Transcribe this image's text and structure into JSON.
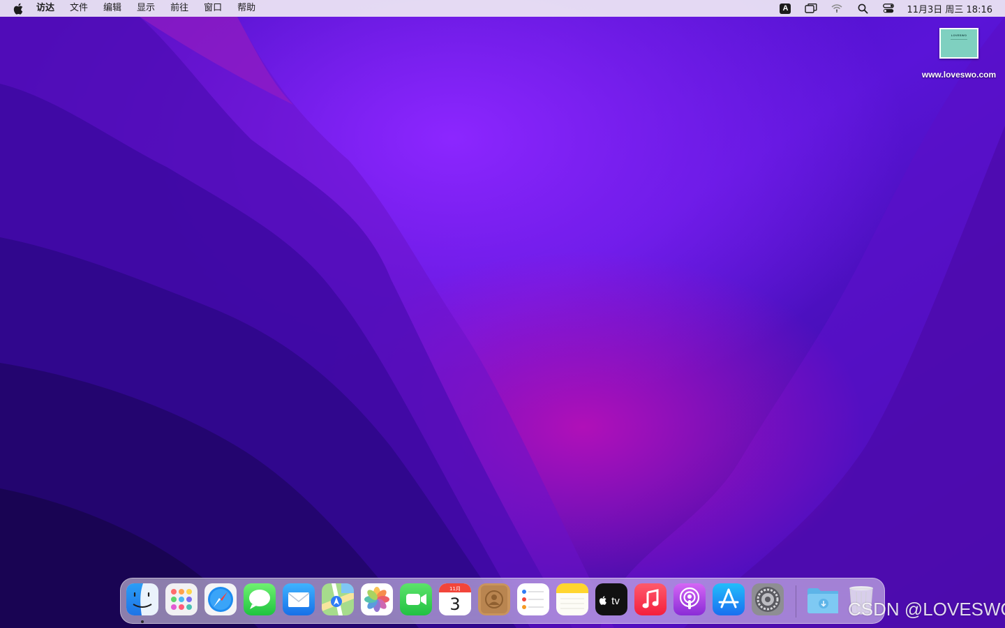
{
  "menubar": {
    "app_name": "访达",
    "items": [
      "文件",
      "编辑",
      "显示",
      "前往",
      "窗口",
      "帮助"
    ],
    "input_source": "A",
    "clock": "11月3日 周三  18:16"
  },
  "desktop": {
    "file_label": "www.loveswo.com",
    "file_thumb_text": "LOVESWO"
  },
  "dock": {
    "apps": [
      "finder-icon",
      "launchpad-icon",
      "safari-icon",
      "messages-icon",
      "mail-icon",
      "maps-icon",
      "photos-icon",
      "facetime-icon",
      "calendar-icon",
      "contacts-icon",
      "reminders-icon",
      "notes-icon",
      "apple-tv-icon",
      "music-icon",
      "podcasts-icon",
      "app-store-icon",
      "system-preferences-icon",
      "downloads-folder-icon",
      "trash-icon"
    ],
    "calendar_month": "11月",
    "calendar_day": "3",
    "tv_label": "tv",
    "running": [
      "finder-icon"
    ]
  },
  "colors": {
    "wallpaper_base": "#3a08a8",
    "wallpaper_highlight": "#8a1ff7",
    "wallpaper_magenta": "#a40bb8"
  },
  "watermark": "CSDN @LOVESWO"
}
